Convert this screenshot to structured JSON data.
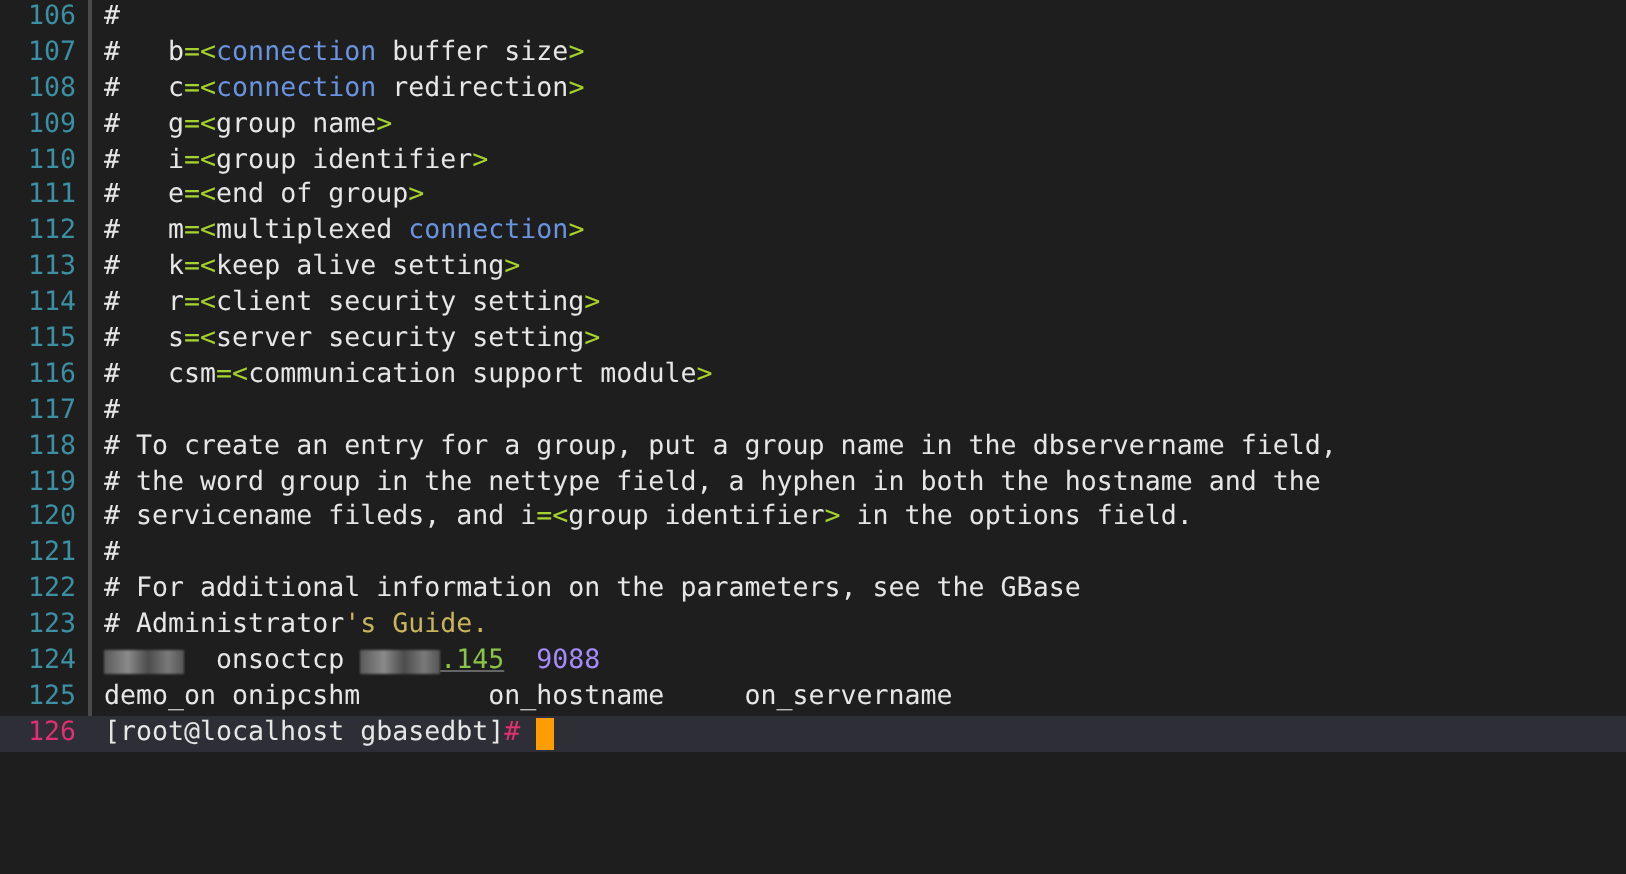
{
  "editor": {
    "lines": [
      {
        "number": "106",
        "current": false,
        "segments": [
          {
            "kind": "text",
            "text": "#"
          }
        ]
      },
      {
        "number": "107",
        "current": false,
        "segments": [
          {
            "kind": "text",
            "text": "#   b"
          },
          {
            "kind": "punct",
            "text": "=<"
          },
          {
            "kind": "keyword",
            "text": "connection"
          },
          {
            "kind": "text",
            "text": " buffer size"
          },
          {
            "kind": "punct",
            "text": ">"
          }
        ]
      },
      {
        "number": "108",
        "current": false,
        "segments": [
          {
            "kind": "text",
            "text": "#   c"
          },
          {
            "kind": "punct",
            "text": "=<"
          },
          {
            "kind": "keyword",
            "text": "connection"
          },
          {
            "kind": "text",
            "text": " redirection"
          },
          {
            "kind": "punct",
            "text": ">"
          }
        ]
      },
      {
        "number": "109",
        "current": false,
        "segments": [
          {
            "kind": "text",
            "text": "#   g"
          },
          {
            "kind": "punct",
            "text": "=<"
          },
          {
            "kind": "text",
            "text": "group name"
          },
          {
            "kind": "punct",
            "text": ">"
          }
        ]
      },
      {
        "number": "110",
        "current": false,
        "segments": [
          {
            "kind": "text",
            "text": "#   i"
          },
          {
            "kind": "punct",
            "text": "=<"
          },
          {
            "kind": "text",
            "text": "group identifier"
          },
          {
            "kind": "punct",
            "text": ">"
          }
        ]
      },
      {
        "number": "111",
        "current": false,
        "segments": [
          {
            "kind": "text",
            "text": "#   e"
          },
          {
            "kind": "punct",
            "text": "=<"
          },
          {
            "kind": "text",
            "text": "end of group"
          },
          {
            "kind": "punct",
            "text": ">"
          }
        ]
      },
      {
        "number": "112",
        "current": false,
        "segments": [
          {
            "kind": "text",
            "text": "#   m"
          },
          {
            "kind": "punct",
            "text": "=<"
          },
          {
            "kind": "text",
            "text": "multiplexed "
          },
          {
            "kind": "keyword",
            "text": "connection"
          },
          {
            "kind": "punct",
            "text": ">"
          }
        ]
      },
      {
        "number": "113",
        "current": false,
        "segments": [
          {
            "kind": "text",
            "text": "#   k"
          },
          {
            "kind": "punct",
            "text": "=<"
          },
          {
            "kind": "text",
            "text": "keep alive setting"
          },
          {
            "kind": "punct",
            "text": ">"
          }
        ]
      },
      {
        "number": "114",
        "current": false,
        "segments": [
          {
            "kind": "text",
            "text": "#   r"
          },
          {
            "kind": "punct",
            "text": "=<"
          },
          {
            "kind": "text",
            "text": "client security setting"
          },
          {
            "kind": "punct",
            "text": ">"
          }
        ]
      },
      {
        "number": "115",
        "current": false,
        "segments": [
          {
            "kind": "text",
            "text": "#   s"
          },
          {
            "kind": "punct",
            "text": "=<"
          },
          {
            "kind": "text",
            "text": "server security setting"
          },
          {
            "kind": "punct",
            "text": ">"
          }
        ]
      },
      {
        "number": "116",
        "current": false,
        "segments": [
          {
            "kind": "text",
            "text": "#   csm"
          },
          {
            "kind": "punct",
            "text": "=<"
          },
          {
            "kind": "text",
            "text": "communication support module"
          },
          {
            "kind": "punct",
            "text": ">"
          }
        ]
      },
      {
        "number": "117",
        "current": false,
        "segments": [
          {
            "kind": "text",
            "text": "#"
          }
        ]
      },
      {
        "number": "118",
        "current": false,
        "segments": [
          {
            "kind": "text",
            "text": "# To create an entry for a group, put a group name in the dbservername field,"
          }
        ]
      },
      {
        "number": "119",
        "current": false,
        "segments": [
          {
            "kind": "text",
            "text": "# the word group in the nettype field, a hyphen in both the hostname and the"
          }
        ]
      },
      {
        "number": "120",
        "current": false,
        "segments": [
          {
            "kind": "text",
            "text": "# servicename fileds, and i"
          },
          {
            "kind": "punct",
            "text": "=<"
          },
          {
            "kind": "text",
            "text": "group identifier"
          },
          {
            "kind": "punct",
            "text": ">"
          },
          {
            "kind": "text",
            "text": " in the options field."
          }
        ]
      },
      {
        "number": "121",
        "current": false,
        "segments": [
          {
            "kind": "text",
            "text": "#"
          }
        ]
      },
      {
        "number": "122",
        "current": false,
        "segments": [
          {
            "kind": "text",
            "text": "# For additional information on the parameters, see the GBase"
          }
        ]
      },
      {
        "number": "123",
        "current": false,
        "segments": [
          {
            "kind": "text",
            "text": "# Administrator"
          },
          {
            "kind": "string",
            "text": "'s Guide."
          }
        ]
      },
      {
        "number": "124",
        "current": false,
        "segments": [
          {
            "kind": "redacted"
          },
          {
            "kind": "text",
            "text": "  onsoctcp "
          },
          {
            "kind": "redacted"
          },
          {
            "kind": "ip",
            "text": ".145"
          },
          {
            "kind": "number",
            "text": "9088"
          }
        ]
      },
      {
        "number": "125",
        "current": false,
        "segments": [
          {
            "kind": "text",
            "text": "demo_on onipcshm        on_hostname     on_servername"
          }
        ]
      },
      {
        "number": "126",
        "current": true,
        "cursor": true,
        "segments": [
          {
            "kind": "text",
            "text": "[root@localhost gbasedbt]"
          },
          {
            "kind": "prompt",
            "text": "#"
          }
        ]
      }
    ]
  }
}
